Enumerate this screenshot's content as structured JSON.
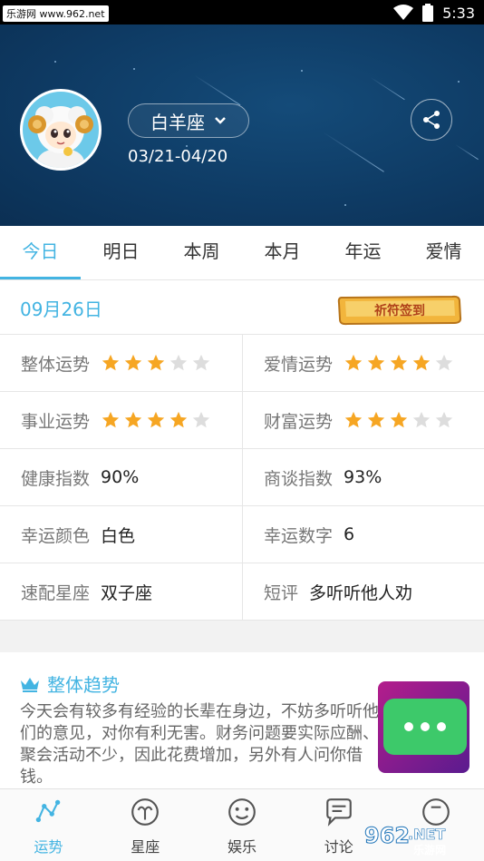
{
  "status_bar": {
    "watermark": "乐游网 www.962.net",
    "time": "5:33"
  },
  "header": {
    "sign_name": "白羊座",
    "date_range": "03/21-04/20"
  },
  "tabs": [
    "今日",
    "明日",
    "本周",
    "本月",
    "年运",
    "爱情"
  ],
  "active_tab": 0,
  "date_label": "09月26日",
  "sign_in_button": "祈符签到",
  "fortune": [
    [
      {
        "label": "整体运势",
        "stars": 3
      },
      {
        "label": "爱情运势",
        "stars": 4
      }
    ],
    [
      {
        "label": "事业运势",
        "stars": 4
      },
      {
        "label": "财富运势",
        "stars": 3
      }
    ],
    [
      {
        "label": "健康指数",
        "value": "90%"
      },
      {
        "label": "商谈指数",
        "value": "93%"
      }
    ],
    [
      {
        "label": "幸运颜色",
        "value": "白色"
      },
      {
        "label": "幸运数字",
        "value": "6"
      }
    ],
    [
      {
        "label": "速配星座",
        "value": "双子座"
      },
      {
        "label": "短评",
        "value": "多听听他人劝"
      }
    ]
  ],
  "max_stars": 5,
  "trend": {
    "title": "整体趋势",
    "text": "今天会有较多有经验的长辈在身边，不妨多听听他们的意见，对你有利无害。财务问题要实际应酬、聚会活动不少，因此花费增加，另外有人问你借钱。"
  },
  "bottom_nav": [
    "运势",
    "星座",
    "娱乐",
    "讨论",
    ""
  ],
  "active_nav": 0,
  "corner_logo": {
    "main": "962",
    "suffix": ".NET",
    "sub": "乐游网"
  },
  "colors": {
    "accent": "#43b4e2",
    "header_bg": "#0e3a63",
    "star_on": "#f6a623",
    "star_off": "#dddddd",
    "chat_green": "#3dc96a"
  },
  "icons": {
    "share": "share-icon",
    "crown": "crown-icon",
    "dropdown": "chevron-down-icon"
  }
}
